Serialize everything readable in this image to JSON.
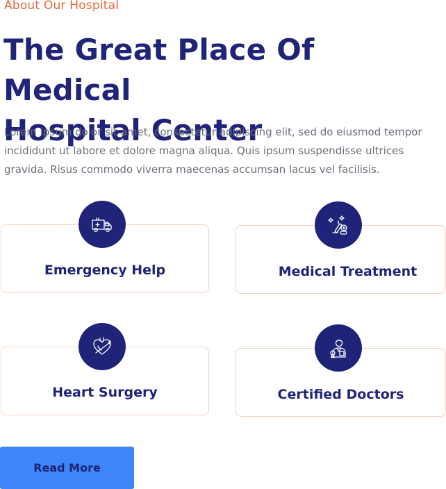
{
  "section": {
    "eyebrow": "About Our Hospital",
    "title_line1": "The Great Place Of Medical",
    "title_line2": "Hospital Center",
    "description": "Lorem ipsum dolor sit amet, consectetur adipiscing elit, sed do eiusmod tempor incididunt ut labore et dolore magna aliqua. Quis ipsum suspendisse ultrices gravida. Risus commodo viverra maecenas accumsan lacus vel facilisis."
  },
  "features": [
    {
      "label": "Emergency Help",
      "icon": "ambulance-icon"
    },
    {
      "label": "Medical Treatment",
      "icon": "medicine-icon"
    },
    {
      "label": "Heart Surgery",
      "icon": "heart-surgery-icon"
    },
    {
      "label": "Certified Doctors",
      "icon": "doctor-icon"
    }
  ],
  "cta": {
    "label": "Read More"
  },
  "colors": {
    "accent": "#e8683d",
    "navy": "#1f2478",
    "button": "#3d86f8",
    "card_border": "#f5d3c3"
  }
}
